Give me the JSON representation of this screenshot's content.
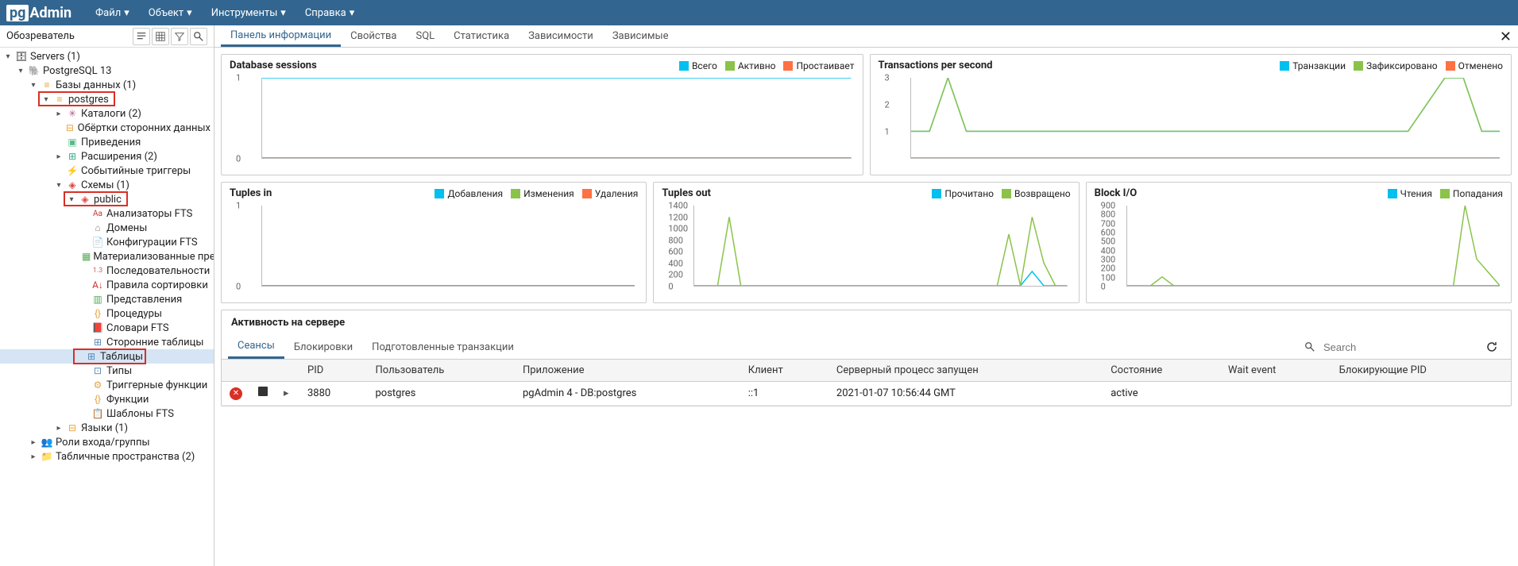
{
  "topbar": {
    "logo_pg": "pg",
    "logo_admin": "Admin",
    "menu": [
      "Файл",
      "Объект",
      "Инструменты",
      "Справка"
    ]
  },
  "sidebar": {
    "title": "Обозреватель",
    "tree": {
      "servers": "Servers (1)",
      "pg13": "PostgreSQL 13",
      "databases": "Базы данных (1)",
      "postgres": "postgres",
      "catalogs": "Каталоги (2)",
      "foreign_wrappers": "Обёртки сторонних данных",
      "casts": "Приведения",
      "extensions": "Расширения (2)",
      "event_triggers": "Событийные триггеры",
      "schemas": "Схемы (1)",
      "public": "public",
      "fts_parsers": "Анализаторы FTS",
      "domains": "Домены",
      "fts_configs": "Конфигурации FTS",
      "mat_views": "Материализованные предста",
      "sequences": "Последовательности",
      "collations": "Правила сортировки",
      "views": "Представления",
      "procedures": "Процедуры",
      "fts_dict": "Словари FTS",
      "foreign_tables": "Сторонние таблицы",
      "tables": "Таблицы",
      "types": "Типы",
      "trigger_funcs": "Триггерные функции",
      "functions": "Функции",
      "fts_templates": "Шаблоны FTS",
      "languages": "Языки (1)",
      "login_roles": "Роли входа/группы",
      "tablespaces": "Табличные пространства (2)"
    }
  },
  "tabs": [
    "Панель информации",
    "Свойства",
    "SQL",
    "Статистика",
    "Зависимости",
    "Зависимые"
  ],
  "panels": {
    "db_sessions": {
      "title": "Database sessions",
      "legend": [
        {
          "label": "Всего",
          "color": "#00c0ef"
        },
        {
          "label": "Активно",
          "color": "#8bc34a"
        },
        {
          "label": "Простаивает",
          "color": "#ff7043"
        }
      ]
    },
    "tps": {
      "title": "Transactions per second",
      "legend": [
        {
          "label": "Транзакции",
          "color": "#00c0ef"
        },
        {
          "label": "Зафиксировано",
          "color": "#8bc34a"
        },
        {
          "label": "Отменено",
          "color": "#ff7043"
        }
      ]
    },
    "tuples_in": {
      "title": "Tuples in",
      "legend": [
        {
          "label": "Добавления",
          "color": "#00c0ef"
        },
        {
          "label": "Изменения",
          "color": "#8bc34a"
        },
        {
          "label": "Удаления",
          "color": "#ff7043"
        }
      ]
    },
    "tuples_out": {
      "title": "Tuples out",
      "legend": [
        {
          "label": "Прочитано",
          "color": "#00c0ef"
        },
        {
          "label": "Возвращено",
          "color": "#8bc34a"
        }
      ]
    },
    "block_io": {
      "title": "Block I/O",
      "legend": [
        {
          "label": "Чтения",
          "color": "#00c0ef"
        },
        {
          "label": "Попадания",
          "color": "#8bc34a"
        }
      ]
    }
  },
  "activity": {
    "title": "Активность на сервере",
    "tabs": [
      "Сеансы",
      "Блокировки",
      "Подготовленные транзакции"
    ],
    "search_placeholder": "Search",
    "columns": [
      "",
      "",
      "",
      "PID",
      "Пользователь",
      "Приложение",
      "Клиент",
      "Серверный процесс запущен",
      "Состояние",
      "Wait event",
      "Блокирующие PID"
    ],
    "rows": [
      {
        "pid": "3880",
        "user": "postgres",
        "app": "pgAdmin 4 - DB:postgres",
        "client": "::1",
        "backend_start": "2021-01-07 10:56:44 GMT",
        "state": "active",
        "wait_event": "",
        "blocking": ""
      }
    ]
  },
  "chart_data": [
    {
      "type": "line",
      "title": "Database sessions",
      "ylim": [
        0,
        1
      ],
      "y_ticks": [
        0,
        1
      ],
      "series": [
        {
          "name": "Всего",
          "color": "#00c0ef",
          "values": [
            1,
            1,
            1,
            1,
            1,
            1,
            1,
            1,
            1,
            1
          ]
        },
        {
          "name": "Активно",
          "color": "#8bc34a",
          "values": [
            0,
            0,
            0,
            0,
            0,
            0,
            0,
            0,
            0,
            0
          ]
        },
        {
          "name": "Простаивает",
          "color": "#ff7043",
          "values": [
            0,
            0,
            0,
            0,
            0,
            0,
            0,
            0,
            0,
            0
          ]
        }
      ]
    },
    {
      "type": "line",
      "title": "Transactions per second",
      "ylim": [
        0,
        3
      ],
      "y_ticks": [
        1,
        2,
        3
      ],
      "series": [
        {
          "name": "Транзакции",
          "color": "#00c0ef",
          "values": [
            1,
            1,
            3,
            1,
            1,
            1,
            1,
            1,
            1,
            1,
            1,
            1,
            1,
            1,
            1,
            1,
            1,
            1,
            1,
            1,
            1,
            1,
            1,
            1,
            1,
            1,
            1,
            1,
            2,
            3,
            3,
            1,
            1
          ]
        },
        {
          "name": "Зафиксировано",
          "color": "#8bc34a",
          "values": [
            1,
            1,
            3,
            1,
            1,
            1,
            1,
            1,
            1,
            1,
            1,
            1,
            1,
            1,
            1,
            1,
            1,
            1,
            1,
            1,
            1,
            1,
            1,
            1,
            1,
            1,
            1,
            1,
            2,
            3,
            3,
            1,
            1
          ]
        },
        {
          "name": "Отменено",
          "color": "#ff7043",
          "values": [
            0,
            0,
            0,
            0,
            0,
            0,
            0,
            0,
            0,
            0,
            0,
            0,
            0,
            0,
            0,
            0,
            0,
            0,
            0,
            0,
            0,
            0,
            0,
            0,
            0,
            0,
            0,
            0,
            0,
            0,
            0,
            0,
            0
          ]
        }
      ]
    },
    {
      "type": "line",
      "title": "Tuples in",
      "ylim": [
        0,
        1
      ],
      "y_ticks": [
        0,
        1
      ],
      "series": [
        {
          "name": "Добавления",
          "color": "#00c0ef",
          "values": [
            0,
            0,
            0,
            0,
            0,
            0,
            0,
            0,
            0,
            0
          ]
        },
        {
          "name": "Изменения",
          "color": "#8bc34a",
          "values": [
            0,
            0,
            0,
            0,
            0,
            0,
            0,
            0,
            0,
            0
          ]
        },
        {
          "name": "Удаления",
          "color": "#ff7043",
          "values": [
            0,
            0,
            0,
            0,
            0,
            0,
            0,
            0,
            0,
            0
          ]
        }
      ]
    },
    {
      "type": "line",
      "title": "Tuples out",
      "ylim": [
        0,
        1400
      ],
      "y_ticks": [
        0,
        200,
        400,
        600,
        800,
        1000,
        1200,
        1400
      ],
      "series": [
        {
          "name": "Прочитано",
          "color": "#00c0ef",
          "values": [
            0,
            0,
            0,
            0,
            0,
            0,
            0,
            0,
            0,
            0,
            0,
            0,
            0,
            0,
            0,
            0,
            0,
            0,
            0,
            0,
            0,
            0,
            0,
            0,
            0,
            0,
            0,
            0,
            0,
            250,
            0,
            0,
            0
          ]
        },
        {
          "name": "Возвращено",
          "color": "#8bc34a",
          "values": [
            0,
            0,
            0,
            1200,
            0,
            0,
            0,
            0,
            0,
            0,
            0,
            0,
            0,
            0,
            0,
            0,
            0,
            0,
            0,
            0,
            0,
            0,
            0,
            0,
            0,
            0,
            0,
            900,
            0,
            1200,
            400,
            0,
            0
          ]
        }
      ]
    },
    {
      "type": "line",
      "title": "Block I/O",
      "ylim": [
        0,
        900
      ],
      "y_ticks": [
        0,
        100,
        200,
        300,
        400,
        500,
        600,
        700,
        800,
        900
      ],
      "series": [
        {
          "name": "Чтения",
          "color": "#00c0ef",
          "values": [
            0,
            0,
            0,
            0,
            0,
            0,
            0,
            0,
            0,
            0,
            0,
            0,
            0,
            0,
            0,
            0,
            0,
            0,
            0,
            0,
            0,
            0,
            0,
            0,
            0,
            0,
            0,
            0,
            0,
            0,
            0,
            0,
            0
          ]
        },
        {
          "name": "Попадания",
          "color": "#8bc34a",
          "values": [
            0,
            0,
            0,
            100,
            0,
            0,
            0,
            0,
            0,
            0,
            0,
            0,
            0,
            0,
            0,
            0,
            0,
            0,
            0,
            0,
            0,
            0,
            0,
            0,
            0,
            0,
            0,
            0,
            0,
            900,
            300,
            150,
            0
          ]
        }
      ]
    }
  ]
}
